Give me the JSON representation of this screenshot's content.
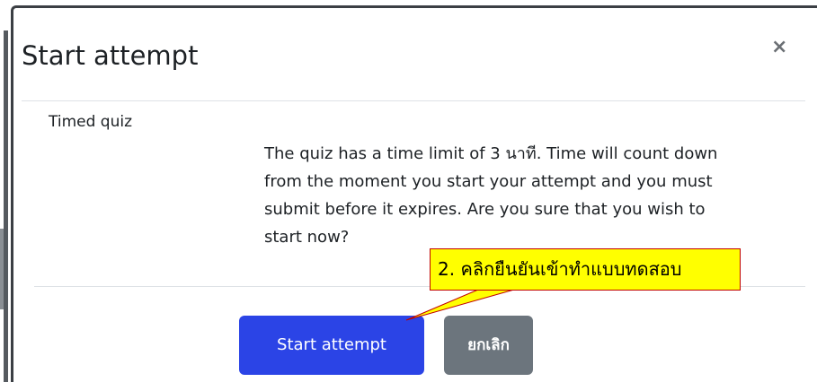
{
  "dialog": {
    "title": "Start attempt",
    "close_glyph": "×",
    "section_label": "Timed quiz",
    "message_lines": [
      "The quiz has a time limit of 3 นาที. Time will count down",
      "from the moment you start your attempt and you must",
      "submit before it expires. Are you sure that you wish to",
      "start now?"
    ],
    "primary_button": "Start attempt",
    "cancel_button": "ยกเลิก"
  },
  "annotation": {
    "callout_text": "2. คลิกยืนยันเข้าทำแบบทดสอบ"
  },
  "colors": {
    "primary_button": "#2b44e6",
    "cancel_button": "#6c757d",
    "callout_fill": "#ffff00",
    "callout_border": "#c00000"
  },
  "icons": {
    "close": "close-icon"
  }
}
